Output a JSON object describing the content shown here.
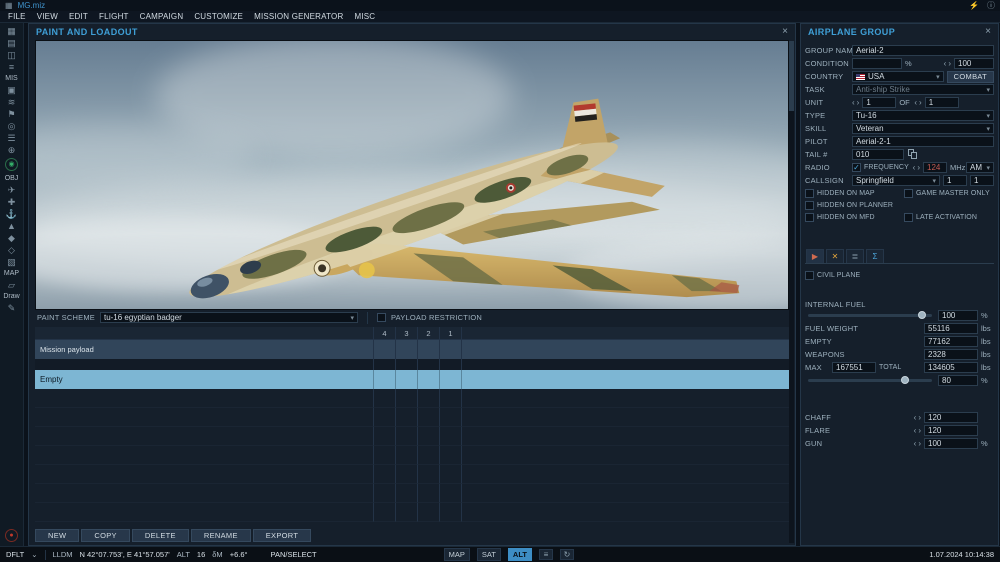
{
  "window": {
    "title": "MG.miz"
  },
  "icons": {
    "app": "▦",
    "power": "⚡",
    "info": "ⓘ",
    "close": "×",
    "chevron_down": "▾",
    "dropdown_small": "⌄",
    "chevron_left": "‹",
    "chevron_right": "›",
    "check": "✓",
    "filter": "≡",
    "refresh": "↻",
    "tab_route": "▶",
    "tab_payload": "✕",
    "tab_systems": "≣",
    "tab_summary": "Σ",
    "record": "●"
  },
  "menubar": {
    "items": [
      "FILE",
      "VIEW",
      "EDIT",
      "FLIGHT",
      "CAMPAIGN",
      "CUSTOMIZE",
      "MISSION GENERATOR",
      "MISC"
    ]
  },
  "left_toolbar": {
    "labels": {
      "mis": "MIS",
      "obj": "OBJ",
      "map": "MAP",
      "draw": "Draw"
    },
    "icons": [
      {
        "name": "new-mission-icon",
        "glyph": "▦"
      },
      {
        "name": "open-mission-icon",
        "glyph": "▤"
      },
      {
        "name": "save-mission-icon",
        "glyph": "◫"
      },
      {
        "name": "mission-options-icon",
        "glyph": "≡"
      },
      {
        "name": "briefing-icon",
        "glyph": "▣"
      },
      {
        "name": "weather-icon",
        "glyph": "≋"
      },
      {
        "name": "triggers-icon",
        "glyph": "⚑"
      },
      {
        "name": "goals-icon",
        "glyph": "◎"
      },
      {
        "name": "lists-icon",
        "glyph": "☰"
      },
      {
        "name": "zones-icon",
        "glyph": "⊕"
      },
      {
        "name": "center-map-icon",
        "glyph": "◉"
      },
      {
        "name": "airplane-icon",
        "glyph": "✈"
      },
      {
        "name": "helicopter-icon",
        "glyph": "✚"
      },
      {
        "name": "ship-icon",
        "glyph": "⚓"
      },
      {
        "name": "vehicle-icon",
        "glyph": "▲"
      },
      {
        "name": "static-object-icon",
        "glyph": "◆"
      },
      {
        "name": "template-icon",
        "glyph": "◇"
      },
      {
        "name": "effects-icon",
        "glyph": "▧"
      },
      {
        "name": "map-layer-icon",
        "glyph": "▱"
      },
      {
        "name": "draw-icon",
        "glyph": "✎"
      },
      {
        "name": "record-icon",
        "glyph": "●"
      }
    ]
  },
  "paint_panel": {
    "title": "PAINT AND LOADOUT",
    "paint_scheme": {
      "label": "PAINT SCHEME",
      "value": "tu-16 egyptian badger"
    },
    "payload_restriction_label": "PAYLOAD RESTRICTION",
    "pylon_columns": [
      "4",
      "3",
      "2",
      "1"
    ],
    "rows": [
      {
        "name": "Mission payload"
      },
      {
        "name": "Empty"
      }
    ],
    "buttons": [
      "NEW",
      "COPY",
      "DELETE",
      "RENAME",
      "EXPORT"
    ]
  },
  "group_panel": {
    "title": "AIRPLANE GROUP",
    "group_name": {
      "label": "GROUP NAME",
      "value": "Aerial-2"
    },
    "condition": {
      "label": "CONDITION",
      "value": "",
      "unit": "%",
      "spin_value": "100"
    },
    "country": {
      "label": "COUNTRY",
      "value": "USA",
      "combat_label": "COMBAT"
    },
    "task": {
      "label": "TASK",
      "value": "Anti-ship Strike"
    },
    "unit": {
      "label": "UNIT",
      "count": "1",
      "of_label": "OF",
      "total": "1"
    },
    "type": {
      "label": "TYPE",
      "value": "Tu-16"
    },
    "skill": {
      "label": "SKILL",
      "value": "Veteran"
    },
    "pilot": {
      "label": "PILOT",
      "value": "Aerial-2-1"
    },
    "tail_number": {
      "label": "TAIL #",
      "value": "010"
    },
    "radio": {
      "label": "RADIO",
      "frequency_label": "FREQUENCY",
      "frequency": "124",
      "unit": "MHz",
      "modulation": "AM"
    },
    "callsign": {
      "label": "CALLSIGN",
      "value": "Springfield",
      "num1": "1",
      "num2": "1"
    },
    "checkboxes": {
      "hidden_on_map": "HIDDEN ON MAP",
      "game_master_only": "GAME MASTER ONLY",
      "hidden_on_planner": "HIDDEN ON PLANNER",
      "hidden_on_mfd": "HIDDEN ON MFD",
      "late_activation": "LATE ACTIVATION"
    },
    "civil_plane_label": "CIVIL PLANE",
    "fuel": {
      "internal_fuel_label": "INTERNAL FUEL",
      "internal_fuel_value": "100",
      "percent_unit": "%",
      "fuel_weight_label": "FUEL WEIGHT",
      "fuel_weight": "55116",
      "empty_label": "EMPTY",
      "empty": "77162",
      "weapons_label": "WEAPONS",
      "weapons": "2328",
      "max_label": "MAX",
      "max": "167551",
      "total_label": "TOTAL",
      "total": "134605",
      "weight_unit": "lbs",
      "fuel_percent": "80"
    },
    "countermeasures": {
      "chaff_label": "CHAFF",
      "chaff": "120",
      "flare_label": "FLARE",
      "flare": "120",
      "gun_label": "GUN",
      "gun": "100",
      "gun_unit": "%"
    }
  },
  "statusbar": {
    "layer": "DFLT",
    "coord_format": "LLDM",
    "coordinates": "N 42°07.753', E 41°57.057'",
    "alt_label": "ALT",
    "alt_value": "16",
    "dm_label": "δM",
    "dm_value": "+6.6°",
    "mode": "PAN/SELECT",
    "map_label": "MAP",
    "sat_label": "SAT",
    "alt_btn_label": "ALT",
    "datetime": "1.07.2024 10:14:38"
  }
}
